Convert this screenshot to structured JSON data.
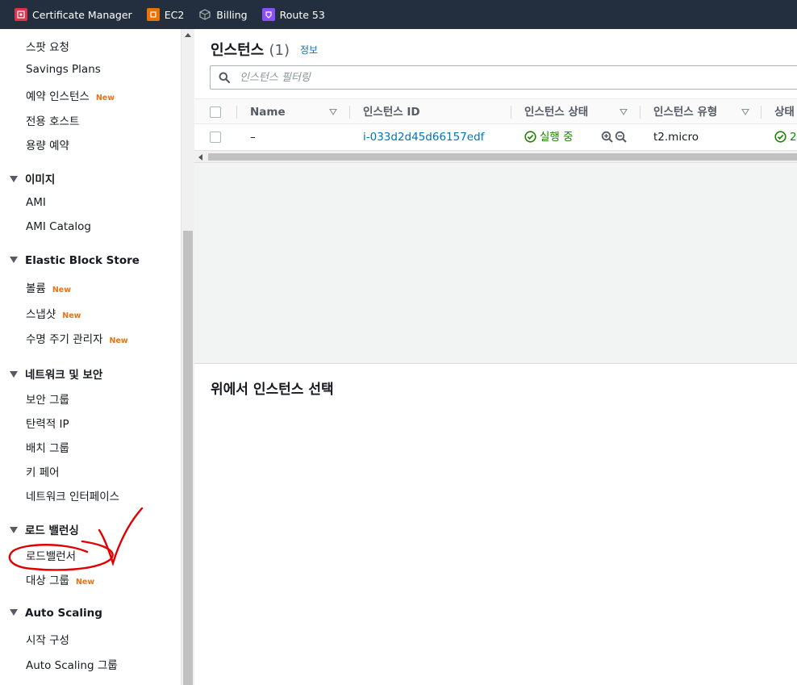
{
  "favorites": [
    {
      "label": "Certificate Manager",
      "icon": "certificate-manager-icon",
      "color": "#dd344c"
    },
    {
      "label": "EC2",
      "icon": "ec2-icon",
      "color": "#ed7100"
    },
    {
      "label": "Billing",
      "icon": "billing-icon",
      "color": "#7aa116"
    },
    {
      "label": "Route 53",
      "icon": "route53-icon",
      "color": "#8c4fff"
    }
  ],
  "sidebar": {
    "items": {
      "spot_requests": "스팟 요청",
      "savings_plans": "Savings Plans",
      "reserved_instances": "예약 인스턴스",
      "dedicated_hosts": "전용 호스트",
      "capacity_reservations": "용량 예약",
      "ami": "AMI",
      "ami_catalog": "AMI Catalog",
      "volumes": "볼륨",
      "snapshots": "스냅샷",
      "lifecycle_manager": "수명 주기 관리자",
      "security_groups": "보안 그룹",
      "elastic_ip": "탄력적 IP",
      "placement_groups": "배치 그룹",
      "key_pairs": "키 페어",
      "network_interfaces": "네트워크 인터페이스",
      "load_balancers": "로드밸런서",
      "target_groups": "대상 그룹",
      "launch_configurations": "시작 구성",
      "auto_scaling_groups": "Auto Scaling 그룹"
    },
    "sections": {
      "images": "이미지",
      "ebs": "Elastic Block Store",
      "network_security": "네트워크 및 보안",
      "load_balancing": "로드 밸런싱",
      "auto_scaling": "Auto Scaling"
    },
    "new_badge": "New"
  },
  "main": {
    "title": "인스턴스",
    "count": "(1)",
    "info": "정보",
    "filter_placeholder": "인스턴스 필터링",
    "columns": [
      "Name",
      "인스턴스 ID",
      "인스턴스 상태",
      "인스턴스 유형",
      "상태"
    ],
    "rows": [
      {
        "name": "–",
        "instance_id": "i-033d2d45d66157edf",
        "state": "실행 중",
        "type": "t2.micro",
        "status_check": "2"
      }
    ],
    "split_panel_title": "위에서 인스턴스 선택"
  }
}
